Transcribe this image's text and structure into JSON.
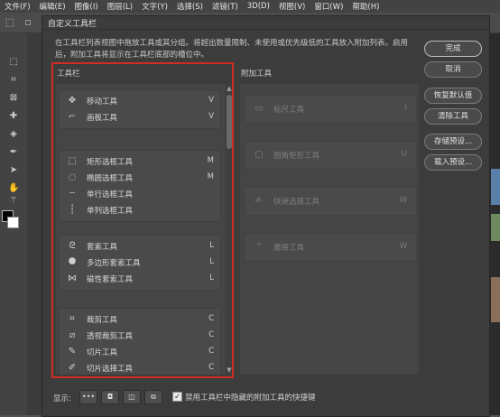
{
  "menubar": [
    "文件(F)",
    "编辑(E)",
    "图像(I)",
    "图层(L)",
    "文字(Y)",
    "选择(S)",
    "滤镜(T)",
    "3D(D)",
    "视图(V)",
    "窗口(W)",
    "帮助(H)"
  ],
  "dialog": {
    "title": "自定义工具栏",
    "description": "在工具栏列表视图中拖放工具或其分组。将超出数量限制、未使用或优先级低的工具放入附加列表。启用后，附加工具将显示在工具栏底部的槽位中。",
    "toolbar_label": "工具栏",
    "extra_label": "附加工具"
  },
  "toolbar_groups": [
    {
      "tools": [
        {
          "icon": "move-icon",
          "glyph": "✥",
          "name": "移动工具",
          "key": "V"
        },
        {
          "icon": "artboard-icon",
          "glyph": "⌐",
          "name": "画板工具",
          "key": "V"
        }
      ]
    },
    {
      "tools": [
        {
          "icon": "rect-marquee-icon",
          "glyph": "⬚",
          "name": "矩形选框工具",
          "key": "M"
        },
        {
          "icon": "ellipse-marquee-icon",
          "glyph": "◌",
          "name": "椭圆选框工具",
          "key": "M"
        },
        {
          "icon": "single-row-marquee-icon",
          "glyph": "┄",
          "name": "单行选框工具",
          "key": ""
        },
        {
          "icon": "single-column-marquee-icon",
          "glyph": "┆",
          "name": "单列选框工具",
          "key": ""
        }
      ]
    },
    {
      "tools": [
        {
          "icon": "lasso-icon",
          "glyph": "ᘓ",
          "name": "套索工具",
          "key": "L"
        },
        {
          "icon": "polygon-lasso-icon",
          "glyph": "⯃",
          "name": "多边形套索工具",
          "key": "L"
        },
        {
          "icon": "magnetic-lasso-icon",
          "glyph": "⋈",
          "name": "磁性套索工具",
          "key": "L"
        }
      ]
    },
    {
      "tools": [
        {
          "icon": "crop-icon",
          "glyph": "⌗",
          "name": "裁剪工具",
          "key": "C"
        },
        {
          "icon": "perspective-crop-icon",
          "glyph": "⧄",
          "name": "透视裁剪工具",
          "key": "C"
        },
        {
          "icon": "slice-icon",
          "glyph": "✎",
          "name": "切片工具",
          "key": "C"
        },
        {
          "icon": "slice-select-icon",
          "glyph": "✐",
          "name": "切片选择工具",
          "key": "C"
        }
      ]
    }
  ],
  "extra_tools": [
    {
      "icon": "ruler-icon",
      "glyph": "▭",
      "name": "标尺工具",
      "key": "I"
    },
    {
      "icon": "rounded-rect-icon",
      "glyph": "▢",
      "name": "圆角矩形工具",
      "key": "U"
    },
    {
      "icon": "quick-select-icon",
      "glyph": "✍",
      "name": "快速选择工具",
      "key": "W"
    },
    {
      "icon": "magic-wand-icon",
      "glyph": "⚚",
      "name": "魔棒工具",
      "key": "W"
    }
  ],
  "buttons": {
    "done": "完成",
    "cancel": "取消",
    "restore_defaults": "恢复默认值",
    "clear_tools": "清除工具",
    "save_preset": "存储预设...",
    "load_preset": "载入预设..."
  },
  "bottom": {
    "show_label": "显示:",
    "show_buttons": [
      "•••",
      "◘",
      "◫",
      "⧉"
    ],
    "checkbox_label": "禁用工具栏中隐藏的附加工具的快捷键",
    "checkbox_checked": true
  },
  "colors": {
    "highlight_frame": "#d12b23"
  }
}
